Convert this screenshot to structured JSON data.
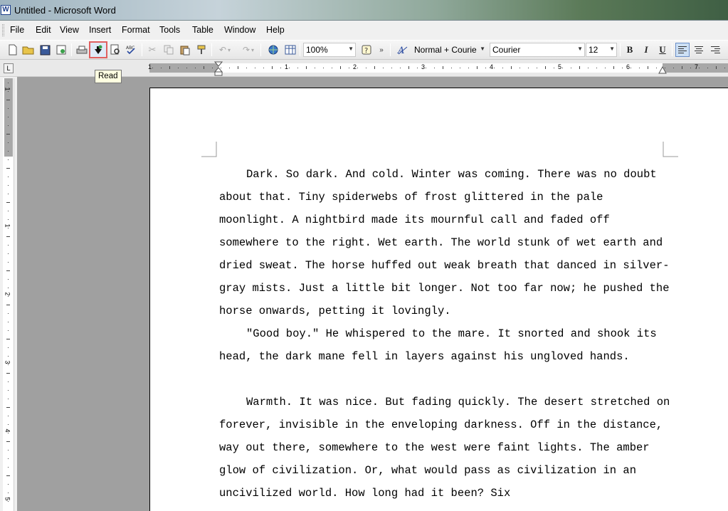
{
  "window": {
    "title": "Untitled - Microsoft Word",
    "app_icon": "W"
  },
  "menu": [
    "File",
    "Edit",
    "View",
    "Insert",
    "Format",
    "Tools",
    "Table",
    "Window",
    "Help"
  ],
  "toolbar": {
    "zoom": "100%",
    "style": "Normal + Courie",
    "font": "Courier",
    "size": "12",
    "bold": "B",
    "italic": "I",
    "underline": "U",
    "read_tooltip": "Read"
  },
  "ruler": {
    "numbers": [
      "1",
      "1",
      "2",
      "3",
      "4",
      "5",
      "6",
      "7"
    ]
  },
  "vruler": {
    "numbers": [
      "1",
      "1",
      "2",
      "3",
      "4",
      "5"
    ]
  },
  "document": {
    "paragraphs": [
      "Dark. So dark. And cold. Winter was coming. There was no doubt about that. Tiny spiderwebs of frost glittered in the pale moonlight. A nightbird made its mournful call and faded off somewhere to the right. Wet earth. The world stunk of wet earth and dried sweat. The horse huffed out weak breath that danced in silver-gray mists. Just a little bit longer. Not too far now; he pushed the horse onwards, petting it lovingly.",
      "\"Good boy.\" He whispered to the mare. It snorted and shook its head, the dark mane fell in layers against his ungloved hands.",
      "Warmth. It was nice. But fading quickly. The desert stretched on forever, invisible in the enveloping darkness. Off in the distance, way out there, somewhere to the west were faint lights. The amber glow of civilization. Or, what would pass as civilization in an uncivilized world. How long had it been? Six"
    ]
  }
}
